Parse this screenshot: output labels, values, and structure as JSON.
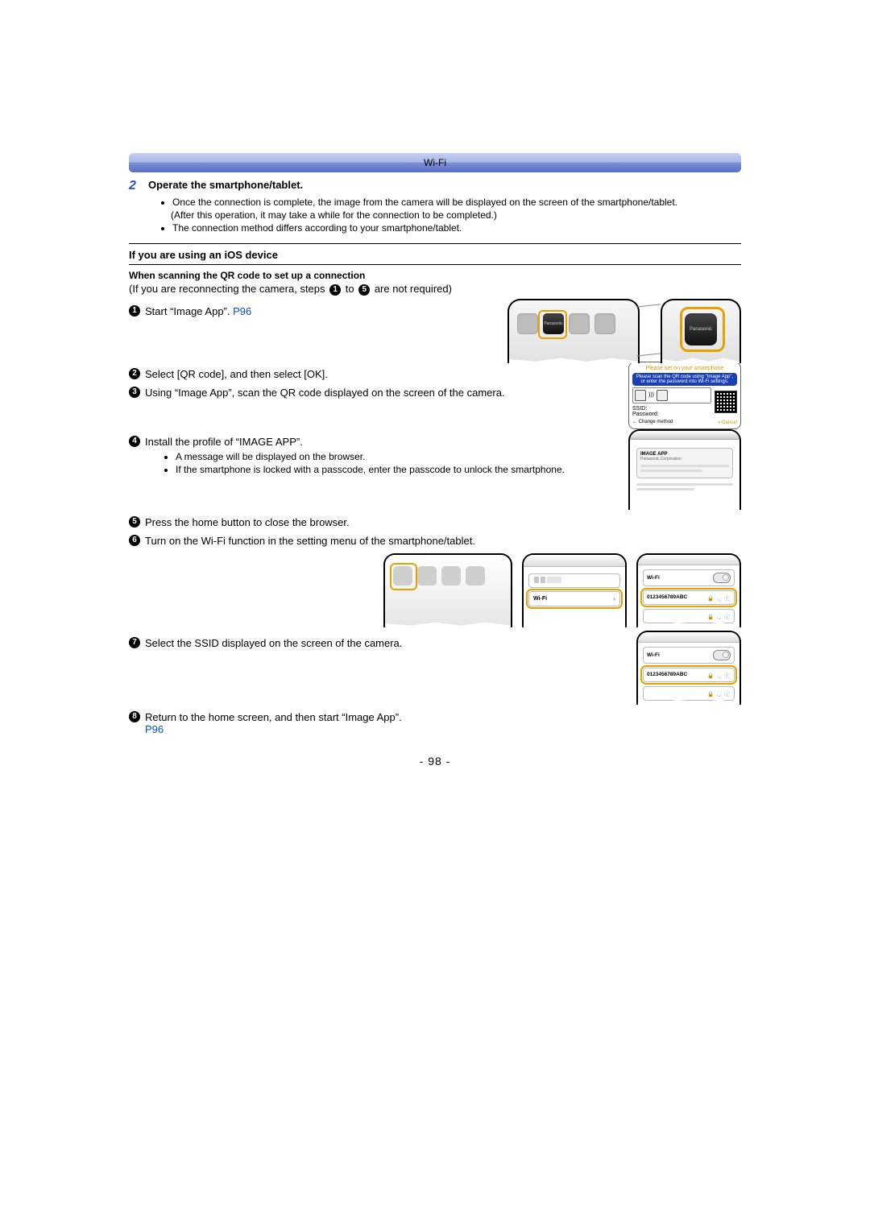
{
  "header": {
    "label": "Wi-Fi"
  },
  "step2": {
    "num": "2",
    "title": "Operate the smartphone/tablet.",
    "bullets": [
      "Once the connection is complete, the image from the camera will be displayed on the screen of the smartphone/tablet.",
      "(After this operation, it may take a while for the connection to be completed.)",
      "The connection method differs according to your smartphone/tablet."
    ]
  },
  "ios": {
    "heading": "If you are using an iOS device",
    "qr_heading": "When scanning the QR code to set up a connection",
    "reconnect_pre": "(If you are reconnecting the camera, steps ",
    "reconnect_mid": " to ",
    "reconnect_post": " are not required)",
    "n1": "1",
    "n5": "5",
    "steps": {
      "1": {
        "text_a": "Start “Image App”. ",
        "link": "P96"
      },
      "2": {
        "text": "Select [QR code], and then select [OK]."
      },
      "3": {
        "text": "Using “Image App”, scan the QR code displayed on the screen of the camera."
      },
      "4": {
        "text": "Install the profile of “IMAGE APP”.",
        "subs": [
          "A message will be displayed on the browser.",
          "If the smartphone is locked with a passcode, enter the passcode to unlock the smartphone."
        ]
      },
      "5": {
        "text": "Press the home button to close the browser."
      },
      "6": {
        "text": "Turn on the Wi-Fi function in the setting menu of the smartphone/tablet."
      },
      "7": {
        "text": "Select the SSID displayed on the screen of the camera."
      },
      "8": {
        "text_a": "Return to the home screen, and then start “Image App”. ",
        "link": "P96"
      }
    }
  },
  "fig": {
    "app_icon_brand": "Panasonic",
    "cam_dialog": {
      "title": "Please set on your smartphone",
      "blue": "Please scan the QR code using \"Image App\", or enter the password into Wi-Fi settings.",
      "ssid_lbl": "SSID:",
      "pwd_lbl": "Password:",
      "change": "Change method",
      "cancel": "Cancel",
      "change_icon": "←",
      "cancel_icon": "↩"
    },
    "browser": {
      "name": "IMAGE APP",
      "vendor": "Panasonic Corporation"
    },
    "settings": {
      "wifi": "Wi-Fi"
    },
    "wifi_panel": {
      "wifi": "Wi-Fi",
      "ssid": "0123456789ABC",
      "lock": "🔒",
      "sig": "◡",
      "info": "ⓘ"
    }
  },
  "page_number": "- 98 -"
}
